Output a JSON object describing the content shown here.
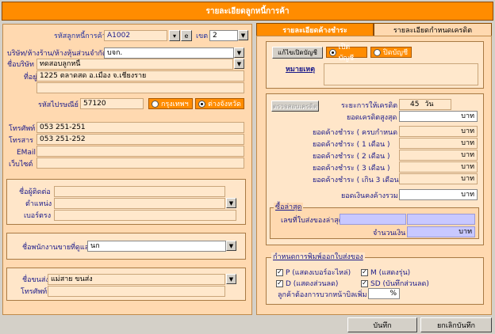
{
  "window": {
    "title": "รายละเอียดลูกหนี้การค้า"
  },
  "customer": {
    "code_label": "รหัสลูกหนี้การค้า",
    "code_value": "A1002",
    "zone_label": "เขต",
    "zone_value": "2",
    "company_type_label": "บริษัท/ห้างร้าน/ห้างหุ้นส่วนจำกัด",
    "company_type_value": "บจก.",
    "company_name_label": "ชื่อบริษัท",
    "company_name_value": "ทดสอบลูกหนี้",
    "address_label": "ที่อยู่",
    "address_value": "1225 ตลาดสด อ.เมือง จ.เชียงราย",
    "postcode_label": "รหัสไปรษณีย์",
    "postcode_value": "57120",
    "radio_bangkok": "กรุงเทพฯ",
    "radio_province": "ต่างจังหวัด",
    "phone_label": "โทรศัพท์",
    "phone_value": "053 251-251",
    "fax_label": "โทรสาร",
    "fax_value": "053 251-252",
    "email_label": "EMail",
    "email_value": "",
    "website_label": "เว็บไซต์",
    "website_value": ""
  },
  "contact": {
    "name_label": "ชื่อผู้ติดต่อ",
    "position_label": "ตำแหน่ง",
    "direct_label": "เบอร์ตรง"
  },
  "salesperson": {
    "label": "ชื่อพนักงานขายที่ดูแล",
    "value": "นก"
  },
  "shipper": {
    "label": "ชื่อขนส่ง",
    "value": "แม่สาย ขนส่ง",
    "phone_label": "โทรศัพท์"
  },
  "tabs": [
    {
      "label": "รายละเอียดค้างชำระ"
    },
    {
      "label": "รายละเอียดกำหนดเครดิต"
    }
  ],
  "account": {
    "edit_button": "แก้ไขเปิดบัญชี",
    "open_label": "เปิดบัญชี",
    "close_label": "ปิดบัญชี",
    "note_label": "หมายเหตุ"
  },
  "credit": {
    "check_button": "ตรวจสอบเครดิต",
    "term_label": "ระยะการให้เครดิต",
    "term_value": "45",
    "term_unit": "วัน",
    "max_label": "ยอดเครดิตสูงสุด",
    "baht": "บาท",
    "rows": [
      {
        "label": "ยอดค้างชำระ ( ครบกำหนด )"
      },
      {
        "label": "ยอดค้างชำระ (   1 เดือน   )"
      },
      {
        "label": "ยอดค้างชำระ (   2 เดือน   )"
      },
      {
        "label": "ยอดค้างชำระ (   3 เดือน   )"
      },
      {
        "label": "ยอดค้างชำระ ( เกิน 3 เดือน)"
      }
    ],
    "total_label": "ยอดเงินคงค้างรวม"
  },
  "latest": {
    "title": "ซื้อล่าสุด",
    "invoice_label": "เลขที่ใบส่งของล่าสุด",
    "amount_label": "จำนวนเงิน",
    "baht": "บาท"
  },
  "print": {
    "title": "กำหนดการพิมพ์ออกใบส่งของ",
    "p_label": "P (แสดงเบอร์อะไหล่)",
    "m_label": "M (แสดงรุ่น)",
    "d_label": "D (แสดงส่วนลด)",
    "sd_label": "SD (บันทึกส่วนลด)",
    "markup_label": "ลูกค้าต้องการบวกหน้าบิลเพิ่ม",
    "percent": "%"
  },
  "buttons": {
    "save": "บันทึก",
    "cancel": "ยกเลิกบันทึก"
  },
  "colors": {
    "accent": "#ff8c00",
    "panel": "#ffd9b0",
    "field": "#ffe8cc",
    "window": "#d4d0c8"
  }
}
